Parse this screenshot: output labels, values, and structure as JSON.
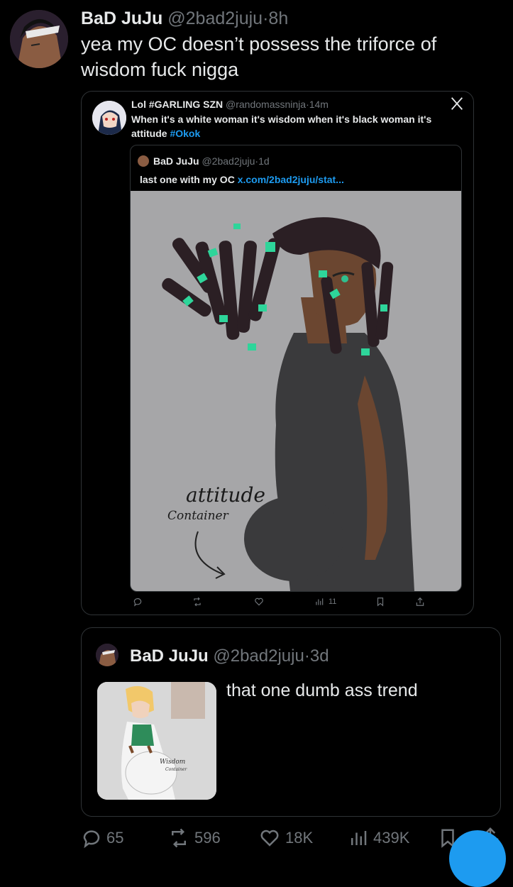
{
  "main_tweet": {
    "display_name": "BaD JuJu",
    "handle": "@2bad2juju",
    "separator": "·",
    "time": "8h",
    "text": "yea my OC doesn’t possess the triforce of wisdom fuck nigga"
  },
  "quoted_tweet": {
    "display_name": "Lol #GARLING SZN",
    "handle": "@randomassninja",
    "separator": "·",
    "time": "14m",
    "text_before": "When it's a white woman it's wisdom when it's black woman it's attitude ",
    "hashtag": "#Okok",
    "close_icon": "x-logo-icon"
  },
  "inner_quote": {
    "display_name": "BaD JuJu",
    "handle": "@2bad2juju",
    "separator": "·",
    "time": "1d",
    "text": "last one with my OC ",
    "link_text": "x.com/2bad2juju/stat..."
  },
  "artwork": {
    "label_line1": "attitude",
    "label_line2": "Container",
    "background": "#a6a6a8"
  },
  "quoted_actions": {
    "views": "11"
  },
  "thread_quote": {
    "display_name": "BaD JuJu",
    "handle": "@2bad2juju",
    "separator": "·",
    "time": "3d",
    "text": "that one dumb ass trend",
    "thumb_label1": "Wisdom",
    "thumb_label2": "Container"
  },
  "actions": {
    "replies": "65",
    "reposts": "596",
    "likes": "18K",
    "views": "439K"
  },
  "colors": {
    "background": "#000000",
    "text": "#e7e9ea",
    "muted": "#71767b",
    "accent": "#1d9bf0",
    "border": "#2f3336"
  }
}
